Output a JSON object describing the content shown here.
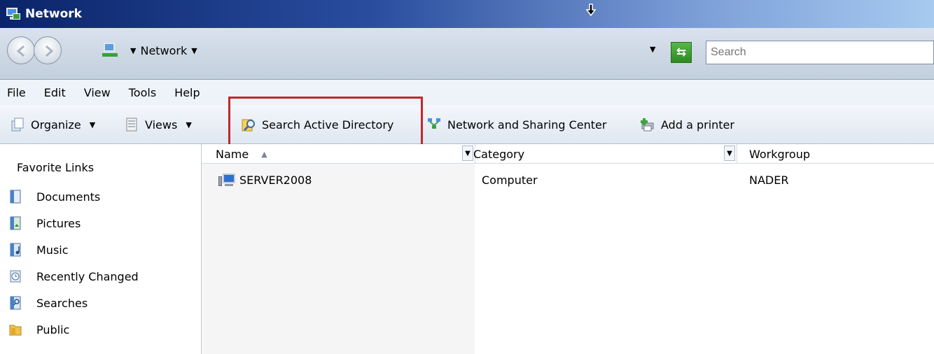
{
  "window": {
    "title": "Network"
  },
  "address_bar": {
    "crumbs": [
      "Network"
    ],
    "search_placeholder": "Search"
  },
  "menu": [
    "File",
    "Edit",
    "View",
    "Tools",
    "Help"
  ],
  "toolbar": {
    "organize": "Organize",
    "views": "Views",
    "search_active_directory": "Search Active Directory",
    "network_and_sharing_center": "Network and Sharing Center",
    "add_a_printer": "Add a printer"
  },
  "sidebar": {
    "heading": "Favorite Links",
    "items": [
      "Documents",
      "Pictures",
      "Music",
      "Recently Changed",
      "Searches",
      "Public"
    ]
  },
  "columns": {
    "name": "Name",
    "category": "Category",
    "workgroup": "Workgroup"
  },
  "rows": [
    {
      "name": "SERVER2008",
      "category": "Computer",
      "workgroup": "NADER"
    }
  ],
  "colors": {
    "highlight_box": "#c0282c",
    "titlebar_start": "#0a246a",
    "titlebar_end": "#a6caf0"
  }
}
